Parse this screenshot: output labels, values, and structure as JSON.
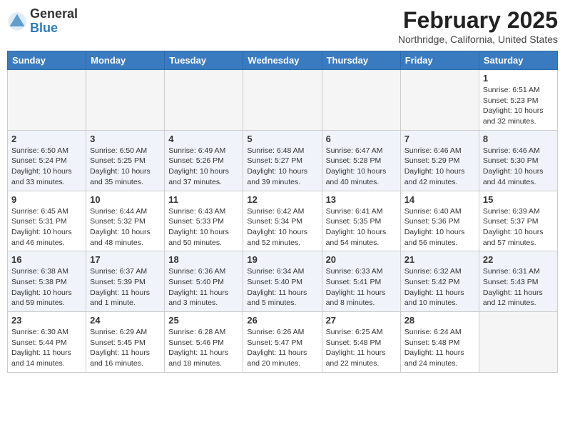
{
  "logo": {
    "general": "General",
    "blue": "Blue"
  },
  "title": "February 2025",
  "location": "Northridge, California, United States",
  "days_of_week": [
    "Sunday",
    "Monday",
    "Tuesday",
    "Wednesday",
    "Thursday",
    "Friday",
    "Saturday"
  ],
  "weeks": [
    [
      {
        "day": "",
        "info": ""
      },
      {
        "day": "",
        "info": ""
      },
      {
        "day": "",
        "info": ""
      },
      {
        "day": "",
        "info": ""
      },
      {
        "day": "",
        "info": ""
      },
      {
        "day": "",
        "info": ""
      },
      {
        "day": "1",
        "info": "Sunrise: 6:51 AM\nSunset: 5:23 PM\nDaylight: 10 hours and 32 minutes."
      }
    ],
    [
      {
        "day": "2",
        "info": "Sunrise: 6:50 AM\nSunset: 5:24 PM\nDaylight: 10 hours and 33 minutes."
      },
      {
        "day": "3",
        "info": "Sunrise: 6:50 AM\nSunset: 5:25 PM\nDaylight: 10 hours and 35 minutes."
      },
      {
        "day": "4",
        "info": "Sunrise: 6:49 AM\nSunset: 5:26 PM\nDaylight: 10 hours and 37 minutes."
      },
      {
        "day": "5",
        "info": "Sunrise: 6:48 AM\nSunset: 5:27 PM\nDaylight: 10 hours and 39 minutes."
      },
      {
        "day": "6",
        "info": "Sunrise: 6:47 AM\nSunset: 5:28 PM\nDaylight: 10 hours and 40 minutes."
      },
      {
        "day": "7",
        "info": "Sunrise: 6:46 AM\nSunset: 5:29 PM\nDaylight: 10 hours and 42 minutes."
      },
      {
        "day": "8",
        "info": "Sunrise: 6:46 AM\nSunset: 5:30 PM\nDaylight: 10 hours and 44 minutes."
      }
    ],
    [
      {
        "day": "9",
        "info": "Sunrise: 6:45 AM\nSunset: 5:31 PM\nDaylight: 10 hours and 46 minutes."
      },
      {
        "day": "10",
        "info": "Sunrise: 6:44 AM\nSunset: 5:32 PM\nDaylight: 10 hours and 48 minutes."
      },
      {
        "day": "11",
        "info": "Sunrise: 6:43 AM\nSunset: 5:33 PM\nDaylight: 10 hours and 50 minutes."
      },
      {
        "day": "12",
        "info": "Sunrise: 6:42 AM\nSunset: 5:34 PM\nDaylight: 10 hours and 52 minutes."
      },
      {
        "day": "13",
        "info": "Sunrise: 6:41 AM\nSunset: 5:35 PM\nDaylight: 10 hours and 54 minutes."
      },
      {
        "day": "14",
        "info": "Sunrise: 6:40 AM\nSunset: 5:36 PM\nDaylight: 10 hours and 56 minutes."
      },
      {
        "day": "15",
        "info": "Sunrise: 6:39 AM\nSunset: 5:37 PM\nDaylight: 10 hours and 57 minutes."
      }
    ],
    [
      {
        "day": "16",
        "info": "Sunrise: 6:38 AM\nSunset: 5:38 PM\nDaylight: 10 hours and 59 minutes."
      },
      {
        "day": "17",
        "info": "Sunrise: 6:37 AM\nSunset: 5:39 PM\nDaylight: 11 hours and 1 minute."
      },
      {
        "day": "18",
        "info": "Sunrise: 6:36 AM\nSunset: 5:40 PM\nDaylight: 11 hours and 3 minutes."
      },
      {
        "day": "19",
        "info": "Sunrise: 6:34 AM\nSunset: 5:40 PM\nDaylight: 11 hours and 5 minutes."
      },
      {
        "day": "20",
        "info": "Sunrise: 6:33 AM\nSunset: 5:41 PM\nDaylight: 11 hours and 8 minutes."
      },
      {
        "day": "21",
        "info": "Sunrise: 6:32 AM\nSunset: 5:42 PM\nDaylight: 11 hours and 10 minutes."
      },
      {
        "day": "22",
        "info": "Sunrise: 6:31 AM\nSunset: 5:43 PM\nDaylight: 11 hours and 12 minutes."
      }
    ],
    [
      {
        "day": "23",
        "info": "Sunrise: 6:30 AM\nSunset: 5:44 PM\nDaylight: 11 hours and 14 minutes."
      },
      {
        "day": "24",
        "info": "Sunrise: 6:29 AM\nSunset: 5:45 PM\nDaylight: 11 hours and 16 minutes."
      },
      {
        "day": "25",
        "info": "Sunrise: 6:28 AM\nSunset: 5:46 PM\nDaylight: 11 hours and 18 minutes."
      },
      {
        "day": "26",
        "info": "Sunrise: 6:26 AM\nSunset: 5:47 PM\nDaylight: 11 hours and 20 minutes."
      },
      {
        "day": "27",
        "info": "Sunrise: 6:25 AM\nSunset: 5:48 PM\nDaylight: 11 hours and 22 minutes."
      },
      {
        "day": "28",
        "info": "Sunrise: 6:24 AM\nSunset: 5:48 PM\nDaylight: 11 hours and 24 minutes."
      },
      {
        "day": "",
        "info": ""
      }
    ]
  ]
}
